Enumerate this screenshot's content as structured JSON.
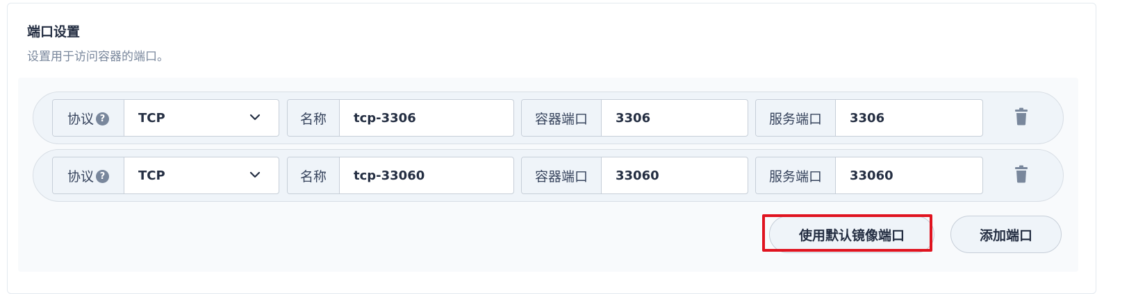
{
  "section": {
    "title": "端口设置",
    "description": "设置用于访问容器的端口。"
  },
  "ports": [
    {
      "protocol_label": "协议",
      "help_icon": "?",
      "protocol": "TCP",
      "name_label": "名称",
      "name": "tcp-3306",
      "container_port_label": "容器端口",
      "container_port": "3306",
      "service_port_label": "服务端口",
      "service_port": "3306"
    },
    {
      "protocol_label": "协议",
      "help_icon": "?",
      "protocol": "TCP",
      "name_label": "名称",
      "name": "tcp-33060",
      "container_port_label": "容器端口",
      "container_port": "33060",
      "service_port_label": "服务端口",
      "service_port": "33060"
    }
  ],
  "actions": {
    "use_default_label": "使用默认镜像端口",
    "add_port_label": "添加端口"
  },
  "colors": {
    "highlight": "#e0131f",
    "row_bg": "#eff4f9",
    "text": "#242e42",
    "muted": "#79879c"
  }
}
